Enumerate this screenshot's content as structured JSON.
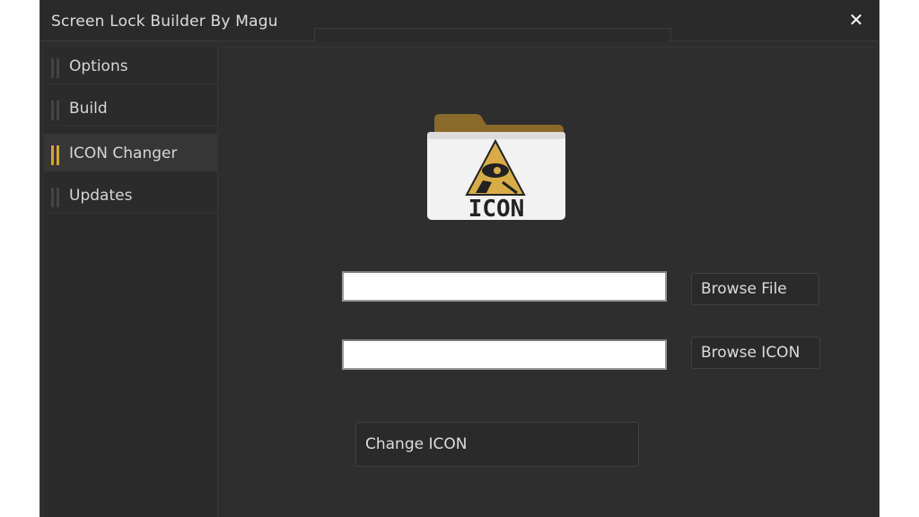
{
  "window": {
    "title": "Screen Lock Builder By Magu",
    "close_label": "✕"
  },
  "sidebar": {
    "items": [
      {
        "label": "Options",
        "active": false
      },
      {
        "label": "Build",
        "active": false
      },
      {
        "label": "ICON Changer",
        "active": true
      },
      {
        "label": "Updates",
        "active": false
      }
    ]
  },
  "main": {
    "icon_text": "ICON",
    "file_input": {
      "value": "",
      "placeholder": ""
    },
    "icon_input": {
      "value": "",
      "placeholder": ""
    },
    "browse_file_label": "Browse File",
    "browse_icon_label": "Browse ICON",
    "change_icon_label": "Change ICON"
  },
  "colors": {
    "accent": "#d4a530",
    "background": "#2e2e2e",
    "folder_tab": "#8a6a2a",
    "icon_triangle": "#d8ad48"
  }
}
